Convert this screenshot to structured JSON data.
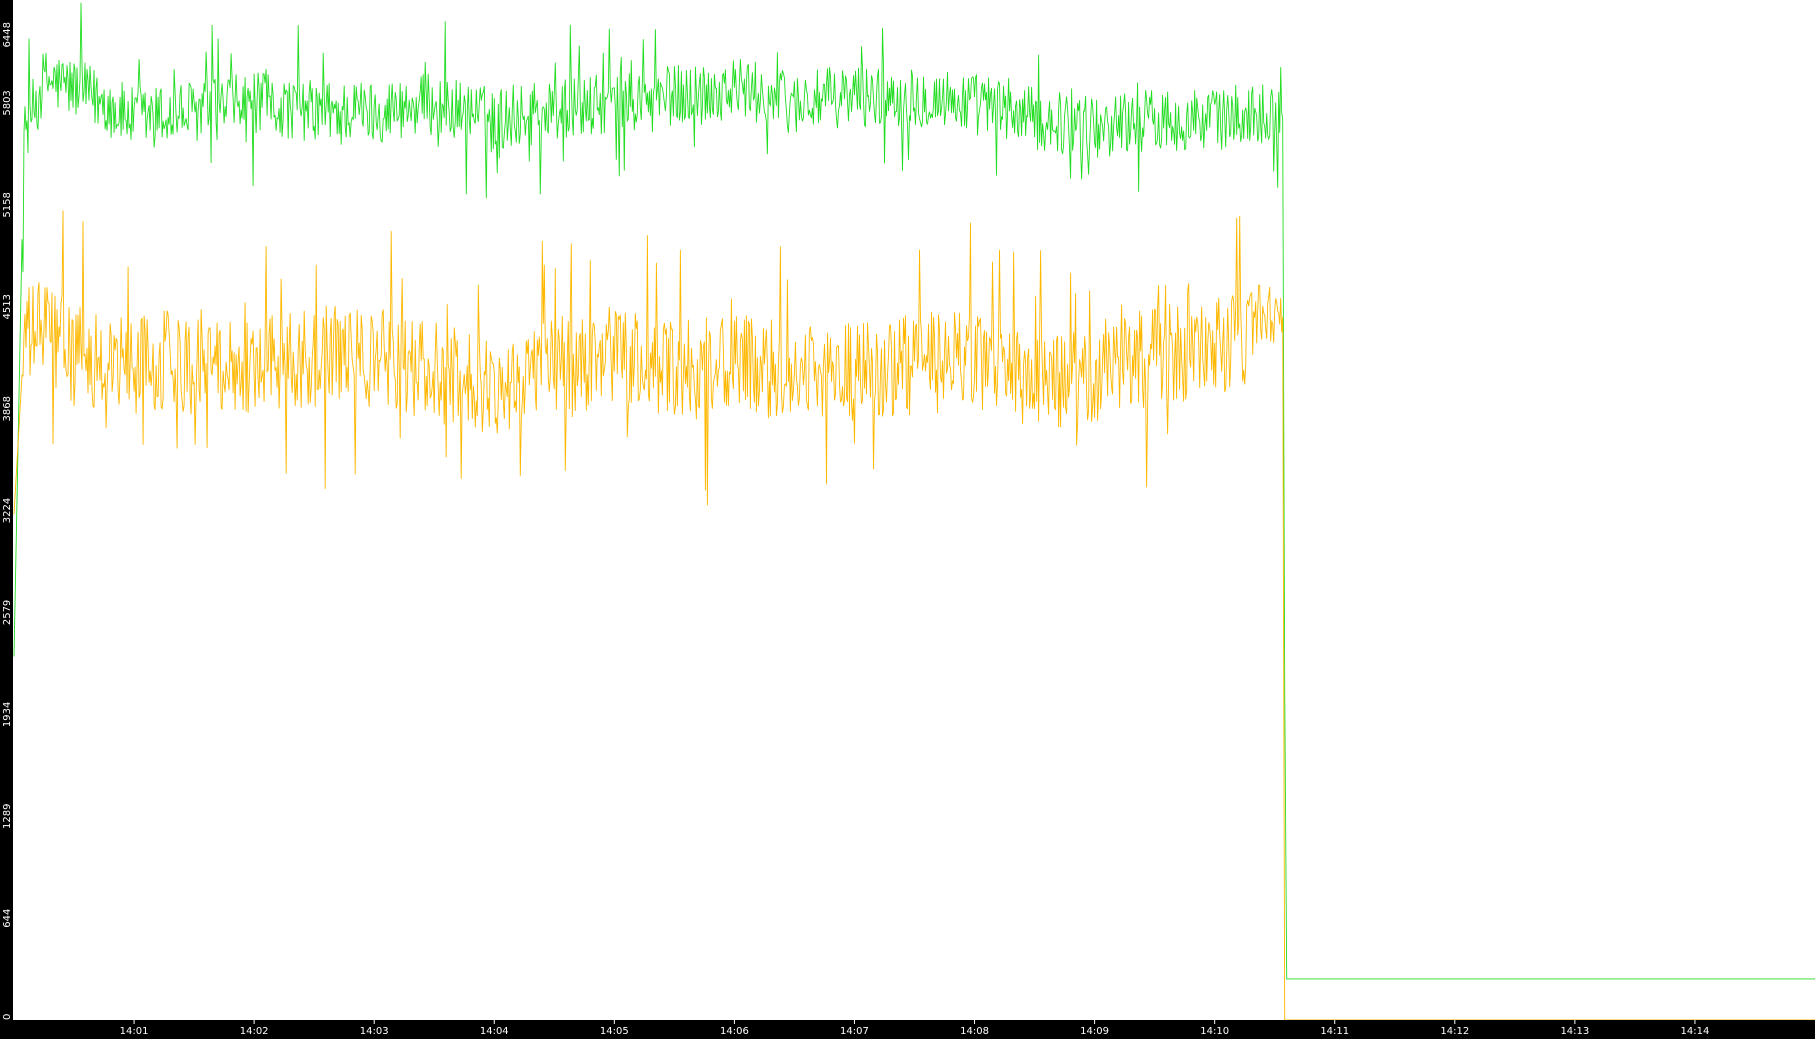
{
  "chart_data": {
    "type": "line",
    "title": "",
    "xlabel": "",
    "ylabel": "",
    "ylim": [
      0,
      6448
    ],
    "xlim": [
      "14:00:00",
      "14:15:00"
    ],
    "yticks": [
      0,
      644,
      1289,
      1934,
      2579,
      3224,
      3868,
      4513,
      5158,
      5803,
      6448
    ],
    "xticks": [
      "14:01",
      "14:02",
      "14:03",
      "14:04",
      "14:05",
      "14:06",
      "14:07",
      "14:08",
      "14:09",
      "14:10",
      "14:11",
      "14:12",
      "14:13",
      "14:14"
    ],
    "grid": false,
    "legend": "none",
    "background": "#000000",
    "series": [
      {
        "color": "#22dd22",
        "x": [
          "14:00:00",
          "14:00:05",
          "14:00:15",
          "14:00:30",
          "14:01:00",
          "14:01:30",
          "14:02:00",
          "14:02:30",
          "14:03:00",
          "14:03:30",
          "14:04:00",
          "14:04:30",
          "14:05:00",
          "14:05:30",
          "14:06:00",
          "14:06:30",
          "14:07:00",
          "14:07:30",
          "14:08:00",
          "14:08:30",
          "14:09:00",
          "14:09:30",
          "14:10:00",
          "14:10:30",
          "14:10:34",
          "14:10:35",
          "14:10:36",
          "14:11:00",
          "14:12:00",
          "14:13:00",
          "14:14:00",
          "14:15:00"
        ],
        "values": [
          2300,
          5600,
          5950,
          5900,
          5700,
          5750,
          5800,
          5750,
          5750,
          5800,
          5700,
          5750,
          5800,
          5850,
          5900,
          5800,
          5850,
          5850,
          5800,
          5700,
          5650,
          5700,
          5700,
          5750,
          5700,
          2100,
          260,
          260,
          260,
          260,
          260,
          260
        ],
        "noise": 200
      },
      {
        "color": "#ffb800",
        "x": [
          "14:00:00",
          "14:00:05",
          "14:00:15",
          "14:00:30",
          "14:01:00",
          "14:01:30",
          "14:02:00",
          "14:02:30",
          "14:03:00",
          "14:03:30",
          "14:04:00",
          "14:04:30",
          "14:05:00",
          "14:05:30",
          "14:06:00",
          "14:06:30",
          "14:07:00",
          "14:07:30",
          "14:08:00",
          "14:08:30",
          "14:09:00",
          "14:09:30",
          "14:10:00",
          "14:10:30",
          "14:10:34",
          "14:10:35",
          "14:10:36",
          "14:15:00"
        ],
        "values": [
          3200,
          4300,
          4400,
          4200,
          4150,
          4200,
          4150,
          4200,
          4200,
          4100,
          4000,
          4150,
          4200,
          4100,
          4150,
          4100,
          4100,
          4150,
          4200,
          4000,
          4100,
          4200,
          4250,
          4400,
          4450,
          0,
          0,
          0
        ],
        "noise": 320
      }
    ]
  }
}
